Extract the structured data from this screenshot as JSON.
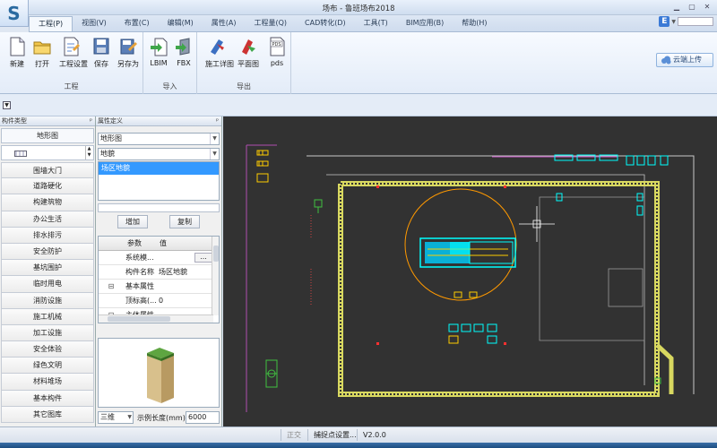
{
  "window": {
    "title": "场布 - 鲁班场布2018"
  },
  "menu": {
    "tabs": [
      {
        "label": "工程(P)",
        "active": true
      },
      {
        "label": "视图(V)"
      },
      {
        "label": "布置(C)"
      },
      {
        "label": "编辑(M)"
      },
      {
        "label": "属性(A)"
      },
      {
        "label": "工程量(Q)"
      },
      {
        "label": "CAD转化(D)"
      },
      {
        "label": "工具(T)"
      },
      {
        "label": "BIM应用(B)"
      },
      {
        "label": "帮助(H)"
      }
    ],
    "help_letter": "E"
  },
  "ribbon": {
    "groups": [
      {
        "label": "工程",
        "buttons": [
          "新建",
          "打开",
          "工程设置",
          "保存",
          "另存为"
        ]
      },
      {
        "label": "导入",
        "buttons": [
          "LBIM",
          "FBX"
        ]
      },
      {
        "label": "导出",
        "buttons": [
          "施工详图",
          "平面图",
          "pds"
        ]
      }
    ],
    "upload_label": "云端上传",
    "pds_icon_text": "PDS"
  },
  "left_panel": {
    "title": "构件类型",
    "type_select": "地形图",
    "categories": [
      "围墙大门",
      "道路硬化",
      "构建筑物",
      "办公生活",
      "排水排污",
      "安全防护",
      "基坑围护",
      "临时用电",
      "消防设施",
      "施工机械",
      "加工设施",
      "安全体验",
      "绿色文明",
      "材料堆场",
      "基本构件",
      "其它图库"
    ]
  },
  "property_panel": {
    "title": "属性定义",
    "combo1": "地形图",
    "combo2": "地貌",
    "list_selected": "场区地貌",
    "add_button": "增加",
    "copy_button": "复制",
    "grid_headers": [
      "参数",
      "值"
    ],
    "grid_rows": [
      {
        "expander": "",
        "name": "系统模...",
        "value": ""
      },
      {
        "expander": "",
        "name": "构件名称",
        "value": "场区地貌"
      },
      {
        "expander": "⊟",
        "name": "基本属性",
        "value": ""
      },
      {
        "expander": "",
        "name": "顶标高(...",
        "value": "0"
      },
      {
        "expander": "⊟",
        "name": "主体属性",
        "value": ""
      }
    ],
    "view_mode": "三维",
    "length_label": "示例长度(mm):",
    "length_value": "6000"
  },
  "status": {
    "items": [
      "正交",
      "捕捉点设置...",
      "V2.0.0"
    ]
  },
  "colors": {
    "canvas_bg": "#323232",
    "road": "#d8d860",
    "selection": "#00ffff",
    "tower_circle": "#ff9900",
    "accent_blue": "#3399ff"
  }
}
